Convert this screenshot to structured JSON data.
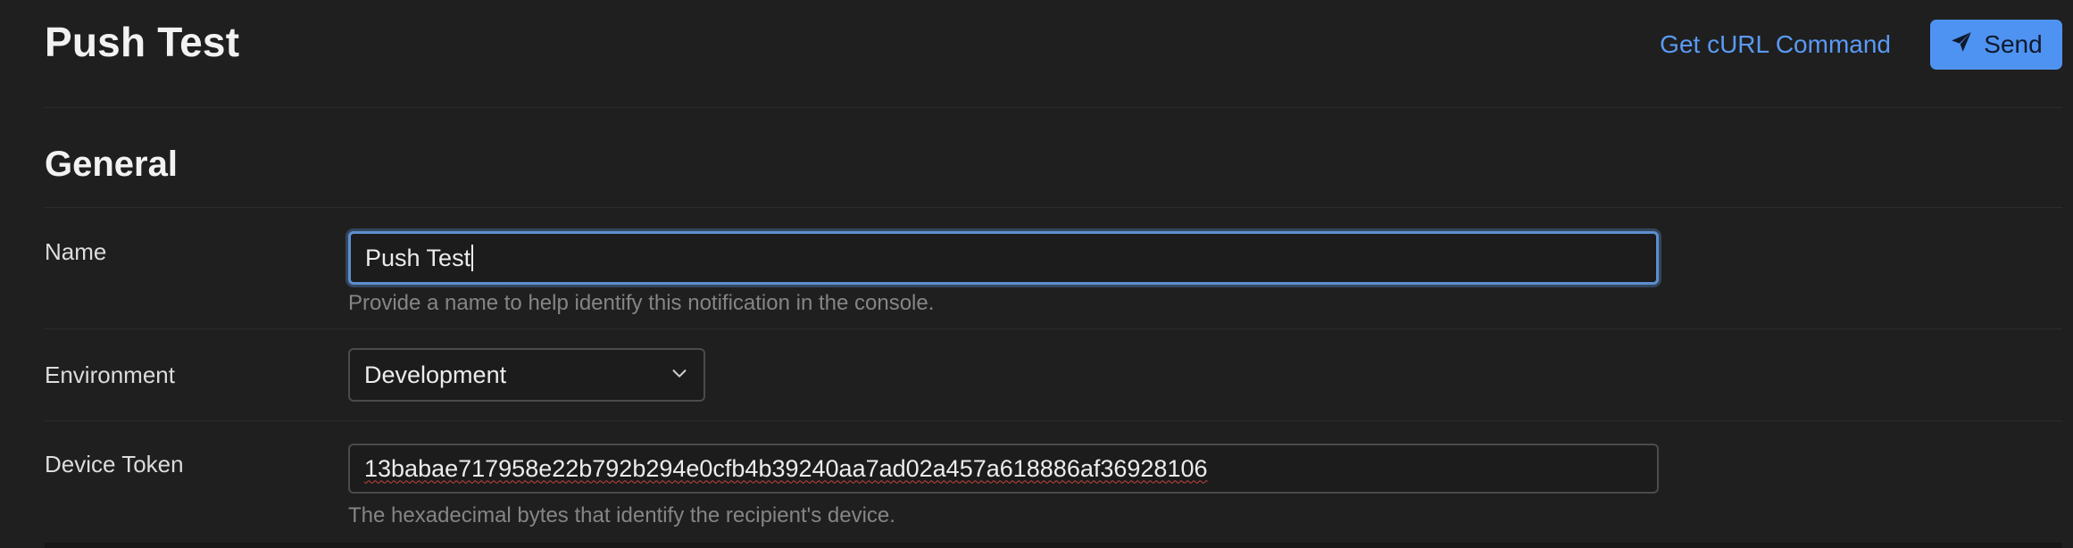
{
  "header": {
    "title": "Push Test",
    "curl_label": "Get cURL Command",
    "send_label": "Send",
    "send_icon": "paper-plane-icon"
  },
  "section": {
    "title": "General"
  },
  "form": {
    "name": {
      "label": "Name",
      "value": "Push Test",
      "hint": "Provide a name to help identify this notification in the console."
    },
    "environment": {
      "label": "Environment",
      "selected": "Development",
      "icon": "chevron-down-icon"
    },
    "device_token": {
      "label": "Device Token",
      "value": "13babae717958e22b792b294e0cfb4b39240aa7ad02a457a618886af36928106",
      "hint": "The hexadecimal bytes that identify the recipient's device."
    }
  },
  "colors": {
    "background": "#1f1f1f",
    "accent": "#4f93f2",
    "link": "#5a9af5",
    "focus_ring": "#5d8fd0",
    "spellcheck_underline": "#c2453d"
  }
}
